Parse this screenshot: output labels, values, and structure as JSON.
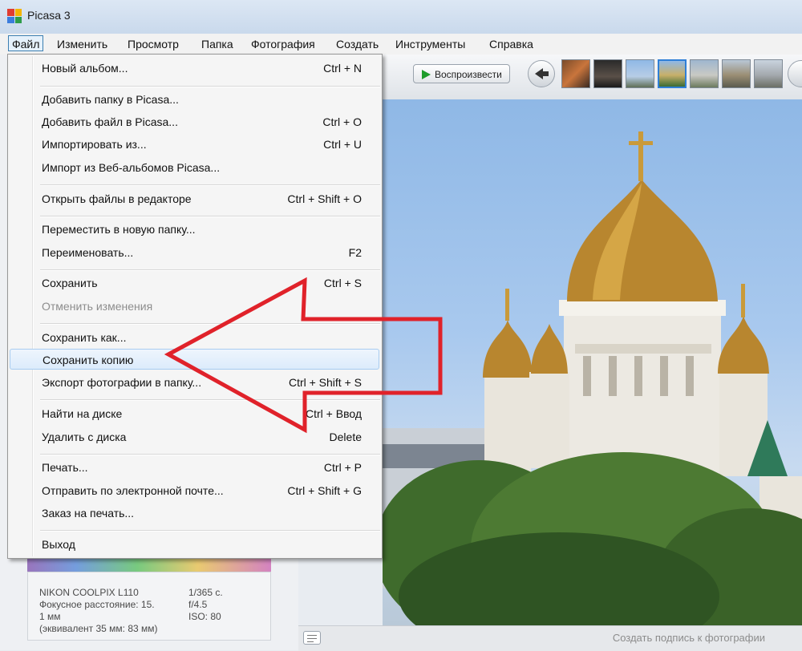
{
  "window": {
    "title": "Picasa 3"
  },
  "menubar": [
    "Файл",
    "Изменить",
    "Просмотр",
    "Папка",
    "Фотография",
    "Создать",
    "Инструменты",
    "Справка"
  ],
  "toolbar": {
    "play_label": "Воспроизвести"
  },
  "file_menu": [
    {
      "label": "Новый альбом...",
      "shortcut": "Ctrl + N"
    },
    {
      "label": "Добавить папку в Picasa...",
      "shortcut": ""
    },
    {
      "label": "Добавить файл в Picasa...",
      "shortcut": "Ctrl + O"
    },
    {
      "label": "Импортировать из...",
      "shortcut": "Ctrl + U"
    },
    {
      "label": "Импорт из Веб-альбомов Picasa...",
      "shortcut": ""
    },
    {
      "label": "Открыть файлы в редакторе",
      "shortcut": "Ctrl + Shift + O"
    },
    {
      "label": "Переместить в новую папку...",
      "shortcut": ""
    },
    {
      "label": "Переименовать...",
      "shortcut": "F2"
    },
    {
      "label": "Сохранить",
      "shortcut": "Ctrl + S"
    },
    {
      "label": "Отменить изменения",
      "shortcut": ""
    },
    {
      "label": "Сохранить как...",
      "shortcut": ""
    },
    {
      "label": "Сохранить копию",
      "shortcut": ""
    },
    {
      "label": "Экспорт фотографии в папку...",
      "shortcut": "Ctrl + Shift + S"
    },
    {
      "label": "Найти на диске",
      "shortcut": "Ctrl + Ввод"
    },
    {
      "label": "Удалить с диска",
      "shortcut": "Delete"
    },
    {
      "label": "Печать...",
      "shortcut": "Ctrl + P"
    },
    {
      "label": "Отправить по электронной почте...",
      "shortcut": "Ctrl + Shift + G"
    },
    {
      "label": "Заказ на печать...",
      "shortcut": ""
    },
    {
      "label": "Выход",
      "shortcut": ""
    }
  ],
  "photo_info": {
    "camera": "NIKON COOLPIX L110",
    "focal_line1": "Фокусное расстояние: 15.",
    "focal_line2": "1 мм",
    "equiv": "(эквивалент 35 мм:  83 мм)",
    "shutter": "1/365 с.",
    "aperture": "f/4.5",
    "iso": "ISO: 80"
  },
  "caption_placeholder": "Создать подпись к фотографии",
  "colors": {
    "accent_arrow": "#e0222a",
    "highlight": "#dcebfb",
    "play_icon": "#1e9c2b"
  }
}
